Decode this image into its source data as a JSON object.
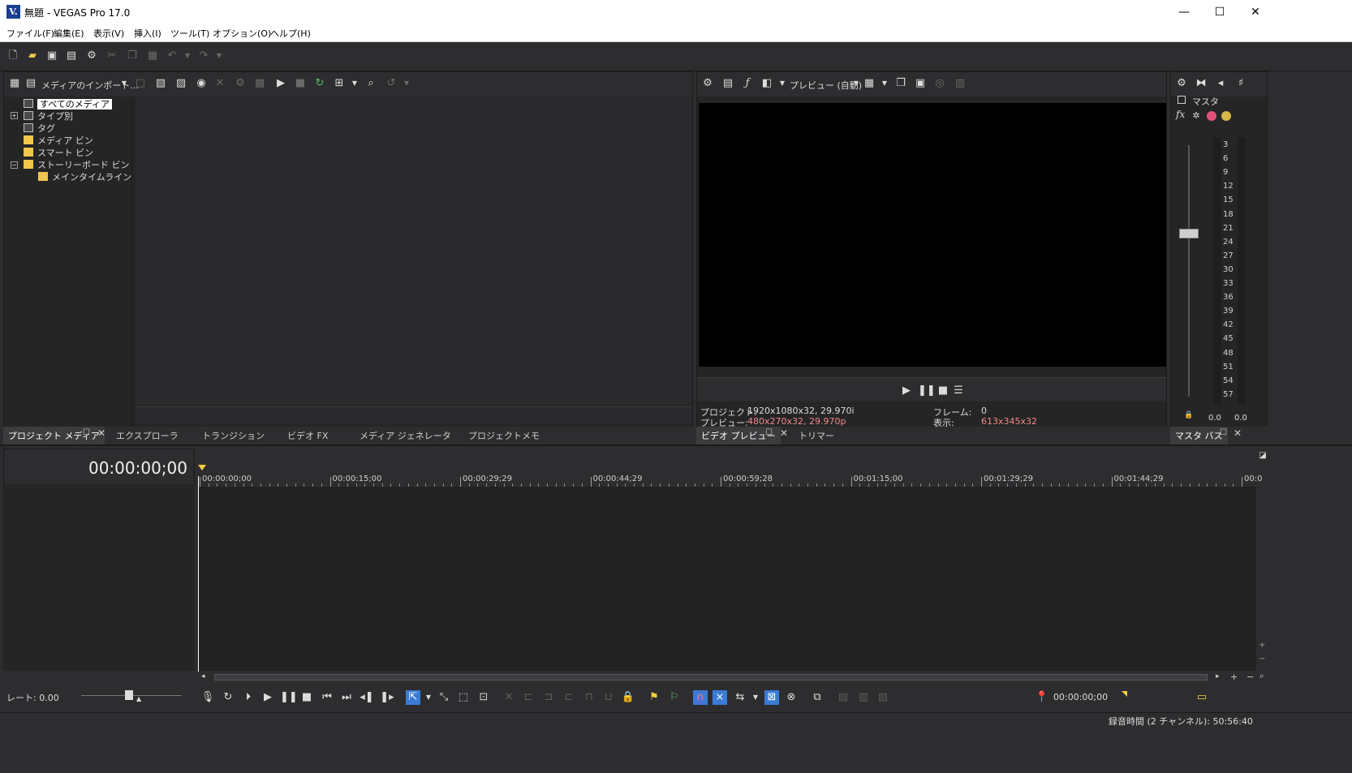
{
  "window": {
    "app_icon_letter": "V.",
    "title": "無題 - VEGAS Pro 17.0",
    "minimize": "—",
    "maximize": "☐",
    "close": "✕"
  },
  "menu": [
    "ファイル(F)",
    "編集(E)",
    "表示(V)",
    "挿入(I)",
    "ツール(T)",
    "オプション(O)",
    "ヘルプ(H)"
  ],
  "project_media": {
    "import_label": "メディアのインポート...",
    "tree": {
      "all_media": "すべてのメディア",
      "by_type": "タイプ別",
      "tags": "タグ",
      "media_bin": "メディア ビン",
      "smart_bin": "スマート ビン",
      "storyboard_bin": "ストーリーボード ビン",
      "main_timeline": "メインタイムライン"
    }
  },
  "left_tabs": [
    "プロジェクト メディア",
    "エクスプローラ",
    "トランジション",
    "ビデオ FX",
    "メディア ジェネレータ",
    "プロジェクトメモ"
  ],
  "preview": {
    "mode_label": "プレビュー (自動)",
    "info": {
      "project_label": "プロジェクト:",
      "project_value": "1920x1080x32, 29.970i",
      "preview_label": "プレビュー:",
      "preview_value": "480x270x32, 29.970p",
      "frame_label": "フレーム:",
      "frame_value": "0",
      "display_label": "表示:",
      "display_value": "613x345x32"
    },
    "tabs": [
      "ビデオ プレビュー",
      "トリマー"
    ],
    "value_color": "#f08a8a"
  },
  "master": {
    "label": "マスタ",
    "fx_label": "fx",
    "scale": [
      "3",
      "6",
      "9",
      "12",
      "15",
      "18",
      "21",
      "24",
      "27",
      "30",
      "33",
      "36",
      "39",
      "42",
      "45",
      "48",
      "51",
      "54",
      "57"
    ],
    "left_value": "0.0",
    "right_value": "0.0",
    "tab": "マスタ バス"
  },
  "timeline": {
    "timecode": "00:00:00;00",
    "ruler": [
      "00:00:00;00",
      "00:00:15;00",
      "00:00:29;29",
      "00:00:44;29",
      "00:00:59;28",
      "00:01:15;00",
      "00:01:29;29",
      "00:01:44;29",
      "00:0"
    ],
    "rate_label": "レート: 0.00",
    "cursor_time": "00:00:00;00",
    "status": "録音時間 (2 チャンネル): 50:56:40"
  },
  "colors": {
    "accent": "#3a7bd5",
    "folder": "#f0c64c",
    "marker": "#f4d03f"
  }
}
